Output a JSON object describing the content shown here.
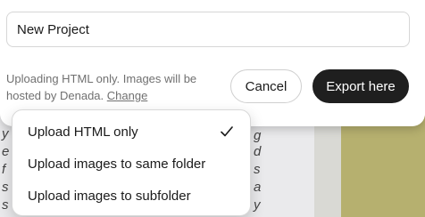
{
  "project_name": {
    "value": "New Project",
    "placeholder": ""
  },
  "upload_note": {
    "text": "Uploading HTML only. Images will be hosted by Denada.",
    "link": "Change"
  },
  "buttons": {
    "cancel": "Cancel",
    "export": "Export here"
  },
  "upload_menu": {
    "selected": "Upload HTML only",
    "items": [
      {
        "label": "Upload HTML only",
        "checked": true
      },
      {
        "label": "Upload images to same folder",
        "checked": false
      },
      {
        "label": "Upload images to subfolder",
        "checked": false
      }
    ]
  },
  "background_text": {
    "lines": [
      "g",
      "s",
      "a",
      "f",
      "s",
      "e",
      "d",
      "y"
    ]
  },
  "colors": {
    "primary_button": "#1f1f1f",
    "olive_panel": "#b6b06f"
  },
  "icons": {
    "selected_check": "checkmark-icon"
  }
}
